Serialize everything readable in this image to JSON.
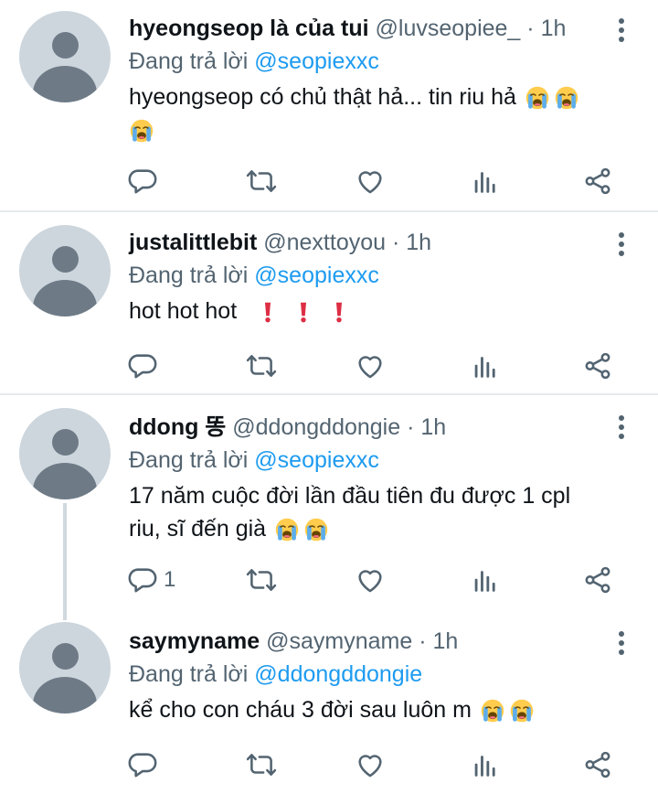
{
  "tweets": [
    {
      "name": "hyeongseop là của tui",
      "handle": "@luvseopiee_",
      "separator": "·",
      "time": "1h",
      "reply_prefix": "Đang trả lời",
      "reply_to": "@seopiexxc",
      "text": "hyeongseop có chủ thật hả... tin riu hả",
      "emoji": [
        "loudly-crying-face",
        "loudly-crying-face",
        "loudly-crying-face"
      ],
      "reply_count": ""
    },
    {
      "name": "justalittlebit",
      "handle": "@nexttoyou",
      "separator": "·",
      "time": "1h",
      "reply_prefix": "Đang trả lời",
      "reply_to": "@seopiexxc",
      "text": "hot hot hot",
      "emoji": [
        "exclamation-mark",
        "exclamation-mark",
        "exclamation-mark"
      ],
      "reply_count": ""
    },
    {
      "name": "ddong 똥",
      "handle": "@ddongddongie",
      "separator": "·",
      "time": "1h",
      "reply_prefix": "Đang trả lời",
      "reply_to": "@seopiexxc",
      "text_line1": "17 năm cuộc đời lần đầu tiên đu được 1 cpl",
      "text_line2": "riu, sĩ đến già",
      "emoji": [
        "loudly-crying-face",
        "loudly-crying-face"
      ],
      "reply_count": "1"
    },
    {
      "name": "saymyname",
      "handle": "@saymyname",
      "separator": "·",
      "time": "1h",
      "reply_prefix": "Đang trả lời",
      "reply_to": "@ddongddongie",
      "text": "kể cho con cháu 3 đời sau luôn m",
      "emoji": [
        "loudly-crying-face",
        "loudly-crying-face"
      ],
      "reply_count": ""
    }
  ],
  "colors": {
    "accent": "#1d9bf0",
    "secondary_text": "#536471",
    "icon": "#536471",
    "divider": "#e6e9ec",
    "avatar_bg": "#cdd6dd",
    "avatar_fg": "#6e7b87",
    "exclamation": "#dd2e44"
  },
  "action_icons": [
    "reply-icon",
    "retweet-icon",
    "like-icon",
    "views-icon",
    "share-icon"
  ]
}
